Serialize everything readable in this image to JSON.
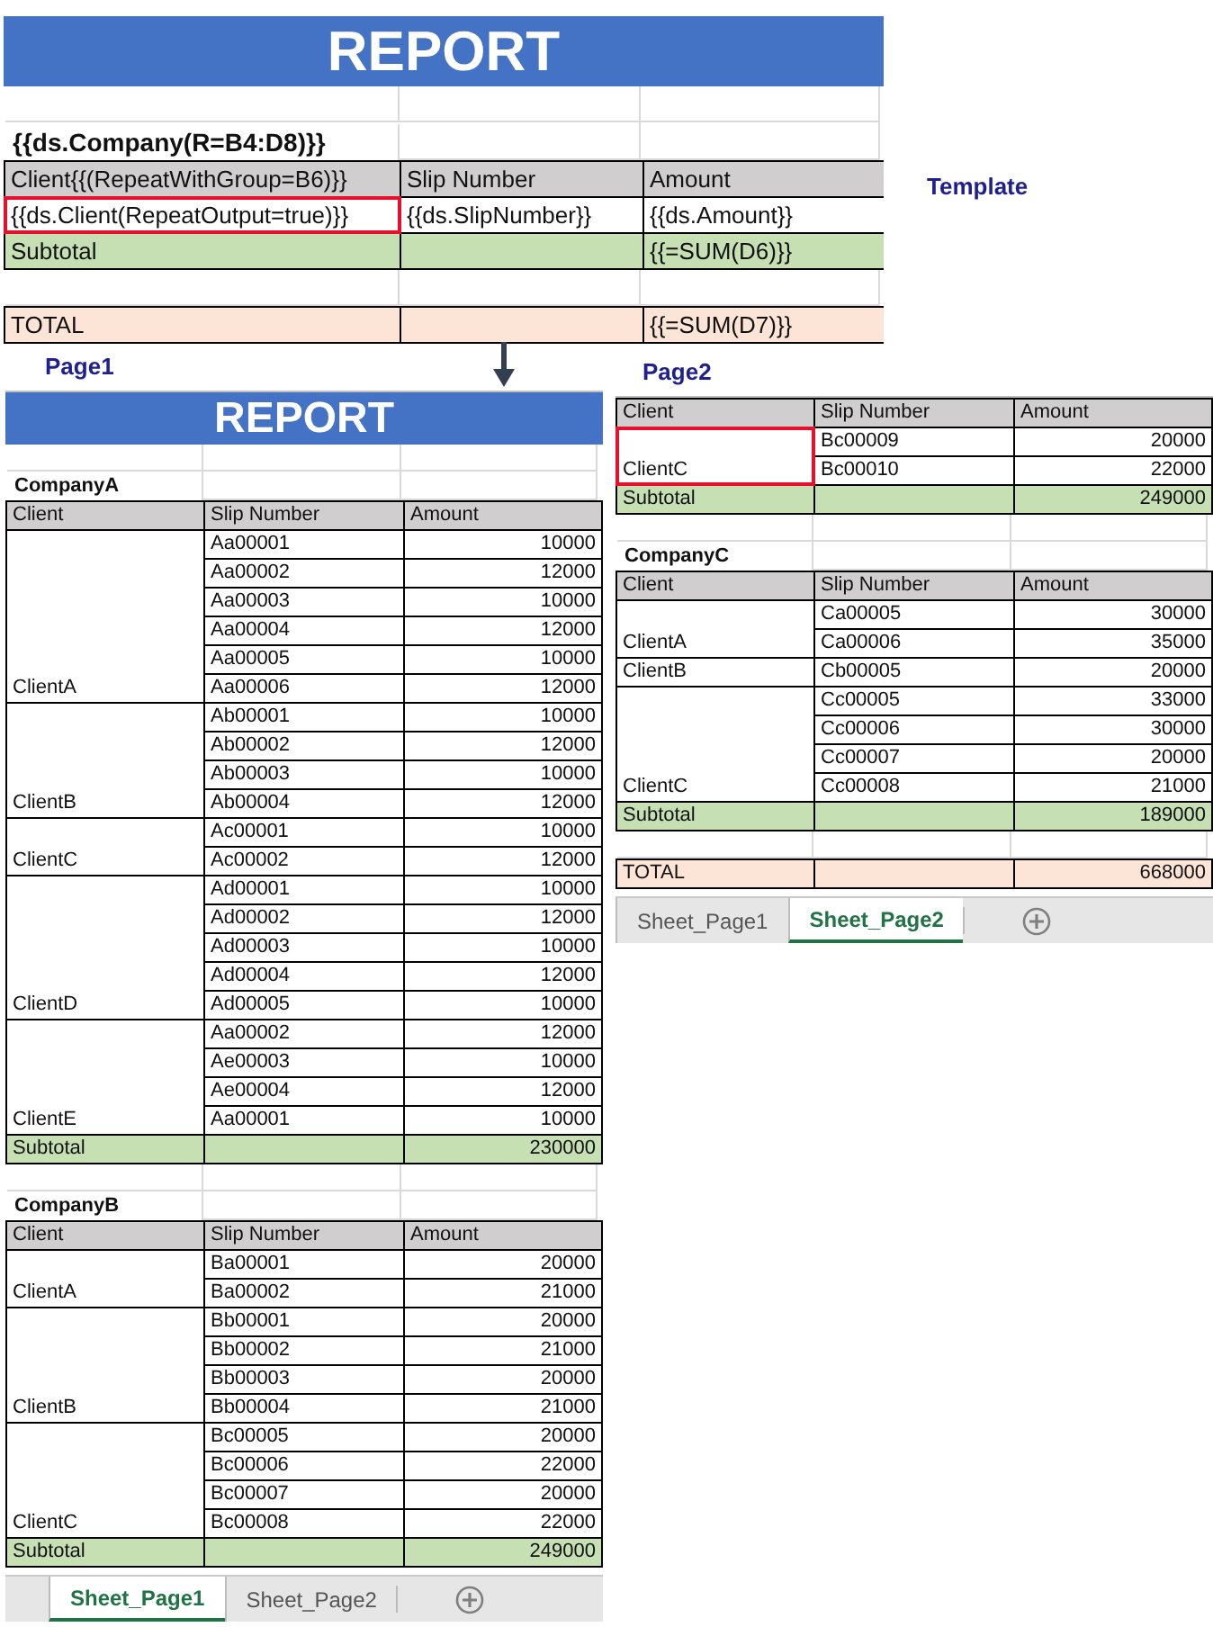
{
  "template": {
    "label": "Template",
    "title": "REPORT",
    "company": "{{ds.Company(R=B4:D8)}}",
    "header": [
      "Client{{(RepeatWithGroup=B6)}}",
      "Slip Number",
      "Amount"
    ],
    "cells": [
      {
        "text": "{{ds.Client(RepeatOutput=true)}}",
        "highlighted": true
      },
      {
        "text": "{{ds.SlipNumber}}",
        "highlighted": false
      },
      {
        "text": "{{ds.Amount}}",
        "highlighted": false
      }
    ],
    "subtotal": {
      "label": "Subtotal",
      "value": "{{=SUM(D6)}}"
    },
    "total": {
      "label": "TOTAL",
      "value": "{{=SUM(D7)}}"
    }
  },
  "pages": [
    {
      "label": "Page1",
      "title": "REPORT",
      "sections": [
        {
          "company": "CompanyA",
          "header": [
            "Client",
            "Slip Number",
            "Amount"
          ],
          "groups": [
            {
              "client": "ClientA",
              "highlighted": false,
              "rows": [
                {
                  "slip": "Aa00001",
                  "amount": "10000"
                },
                {
                  "slip": "Aa00002",
                  "amount": "12000"
                },
                {
                  "slip": "Aa00003",
                  "amount": "10000"
                },
                {
                  "slip": "Aa00004",
                  "amount": "12000"
                },
                {
                  "slip": "Aa00005",
                  "amount": "10000"
                },
                {
                  "slip": "Aa00006",
                  "amount": "12000"
                }
              ]
            },
            {
              "client": "ClientB",
              "highlighted": false,
              "rows": [
                {
                  "slip": "Ab00001",
                  "amount": "10000"
                },
                {
                  "slip": "Ab00002",
                  "amount": "12000"
                },
                {
                  "slip": "Ab00003",
                  "amount": "10000"
                },
                {
                  "slip": "Ab00004",
                  "amount": "12000"
                }
              ]
            },
            {
              "client": "ClientC",
              "highlighted": false,
              "rows": [
                {
                  "slip": "Ac00001",
                  "amount": "10000"
                },
                {
                  "slip": "Ac00002",
                  "amount": "12000"
                }
              ]
            },
            {
              "client": "ClientD",
              "highlighted": false,
              "rows": [
                {
                  "slip": "Ad00001",
                  "amount": "10000"
                },
                {
                  "slip": "Ad00002",
                  "amount": "12000"
                },
                {
                  "slip": "Ad00003",
                  "amount": "10000"
                },
                {
                  "slip": "Ad00004",
                  "amount": "12000"
                },
                {
                  "slip": "Ad00005",
                  "amount": "10000"
                }
              ]
            },
            {
              "client": "ClientE",
              "highlighted": false,
              "rows": [
                {
                  "slip": "Aa00002",
                  "amount": "12000"
                },
                {
                  "slip": "Ae00003",
                  "amount": "10000"
                },
                {
                  "slip": "Ae00004",
                  "amount": "12000"
                },
                {
                  "slip": "Aa00001",
                  "amount": "10000"
                }
              ]
            }
          ],
          "subtotal": {
            "label": "Subtotal",
            "value": "230000"
          }
        },
        {
          "company": "CompanyB",
          "header": [
            "Client",
            "Slip Number",
            "Amount"
          ],
          "groups": [
            {
              "client": "ClientA",
              "highlighted": false,
              "rows": [
                {
                  "slip": "Ba00001",
                  "amount": "20000"
                },
                {
                  "slip": "Ba00002",
                  "amount": "21000"
                }
              ]
            },
            {
              "client": "ClientB",
              "highlighted": false,
              "rows": [
                {
                  "slip": "Bb00001",
                  "amount": "20000"
                },
                {
                  "slip": "Bb00002",
                  "amount": "21000"
                },
                {
                  "slip": "Bb00003",
                  "amount": "20000"
                },
                {
                  "slip": "Bb00004",
                  "amount": "21000"
                }
              ]
            },
            {
              "client": "ClientC",
              "highlighted": false,
              "rows": [
                {
                  "slip": "Bc00005",
                  "amount": "20000"
                },
                {
                  "slip": "Bc00006",
                  "amount": "22000"
                },
                {
                  "slip": "Bc00007",
                  "amount": "20000"
                },
                {
                  "slip": "Bc00008",
                  "amount": "22000"
                }
              ]
            }
          ],
          "subtotal": {
            "label": "Subtotal",
            "value": "249000"
          }
        }
      ],
      "tabs": [
        {
          "label": "Sheet_Page1",
          "selected": true
        },
        {
          "label": "Sheet_Page2",
          "selected": false
        }
      ]
    },
    {
      "label": "Page2",
      "sections": [
        {
          "header": [
            "Client",
            "Slip Number",
            "Amount"
          ],
          "groups": [
            {
              "client": "ClientC",
              "highlighted": true,
              "rows": [
                {
                  "slip": "Bc00009",
                  "amount": "20000"
                },
                {
                  "slip": "Bc00010",
                  "amount": "22000"
                }
              ]
            }
          ],
          "subtotal": {
            "label": "Subtotal",
            "value": "249000"
          }
        },
        {
          "company": "CompanyC",
          "header": [
            "Client",
            "Slip Number",
            "Amount"
          ],
          "groups": [
            {
              "client": "ClientA",
              "highlighted": false,
              "rows": [
                {
                  "slip": "Ca00005",
                  "amount": "30000"
                },
                {
                  "slip": "Ca00006",
                  "amount": "35000"
                }
              ]
            },
            {
              "client": "ClientB",
              "highlighted": false,
              "rows": [
                {
                  "slip": "Cb00005",
                  "amount": "20000"
                }
              ]
            },
            {
              "client": "ClientC",
              "highlighted": false,
              "rows": [
                {
                  "slip": "Cc00005",
                  "amount": "33000"
                },
                {
                  "slip": "Cc00006",
                  "amount": "30000"
                },
                {
                  "slip": "Cc00007",
                  "amount": "20000"
                },
                {
                  "slip": "Cc00008",
                  "amount": "21000"
                }
              ]
            }
          ],
          "subtotal": {
            "label": "Subtotal",
            "value": "189000"
          }
        }
      ],
      "total": {
        "label": "TOTAL",
        "value": "668000"
      },
      "tabs": [
        {
          "label": "Sheet_Page1",
          "selected": false
        },
        {
          "label": "Sheet_Page2",
          "selected": true
        }
      ]
    }
  ]
}
